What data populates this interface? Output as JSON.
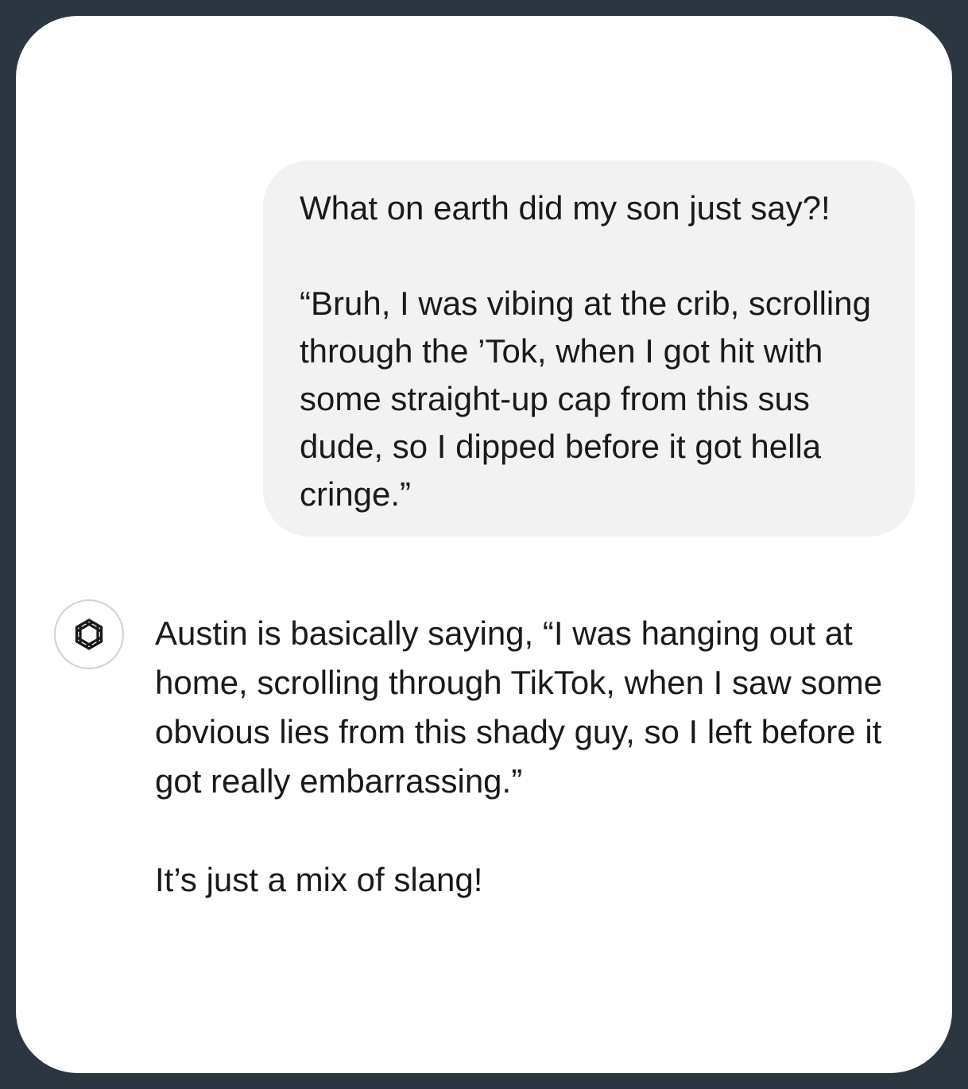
{
  "conversation": {
    "user_message": {
      "paragraphs": [
        "What on earth did my son just say?!",
        "“Bruh, I was vibing at the crib, scrolling through the ’Tok, when I got hit with some straight-up cap from this sus dude, so I dipped before it got hella cringe.”"
      ]
    },
    "assistant_message": {
      "avatar_icon": "openai-logo-icon",
      "paragraphs": [
        "Austin is basically saying, “I was hanging out at home, scrolling through TikTok, when I saw some obvious lies from this shady guy, so I left before it got really embarrassing.”",
        "It’s just a mix of slang!"
      ]
    }
  },
  "colors": {
    "frame": "#2b3640",
    "screen_background": "#ffffff",
    "user_bubble": "#f2f2f2",
    "text": "#1a1a1a",
    "avatar_border": "#d2d2d2"
  }
}
